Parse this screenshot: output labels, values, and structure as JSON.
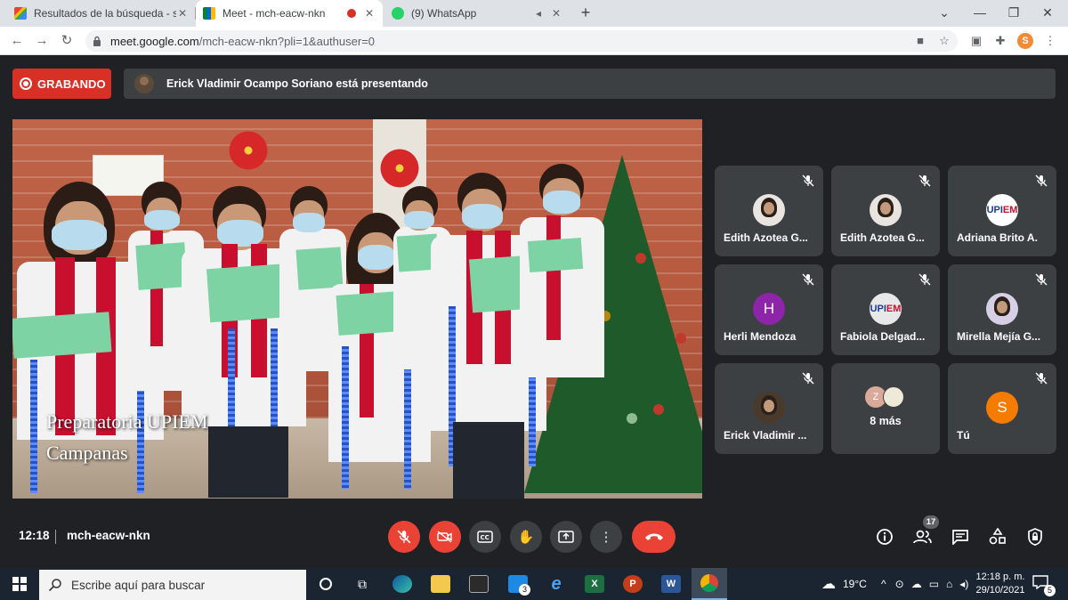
{
  "browser": {
    "tabs": [
      {
        "title": "Resultados de la búsqueda - sub",
        "favicon": "gmail-icon",
        "active": false
      },
      {
        "title": "Meet - mch-eacw-nkn",
        "favicon": "meet-icon",
        "active": true,
        "recording": true
      },
      {
        "title": "(9) WhatsApp",
        "favicon": "whatsapp-icon",
        "active": false,
        "audio": true
      }
    ],
    "url": {
      "host": "meet.google.com",
      "path": "/mch-eacw-nkn?pli=1&authuser=0"
    },
    "profile_initial": "S"
  },
  "meet": {
    "recording_label": "GRABANDO",
    "presenting_text": "Erick Vladimir Ocampo Soriano está presentando",
    "caption_line1": "Preparatoria UPIEM",
    "caption_line2": "Campanas",
    "participants": [
      {
        "name": "Edith Azotea G...",
        "avatar": "photo",
        "muted": true
      },
      {
        "name": "Edith Azotea G...",
        "avatar": "photo",
        "muted": true
      },
      {
        "name": "Adriana Brito A.",
        "avatar": "logo",
        "muted": true
      },
      {
        "name": "Herli Mendoza",
        "avatar": "letter",
        "letter": "H",
        "color": "#8e24aa",
        "muted": true
      },
      {
        "name": "Fabiola Delgad...",
        "avatar": "logo",
        "muted": true
      },
      {
        "name": "Mirella Mejía G...",
        "avatar": "photo",
        "muted": true
      },
      {
        "name": "Erick Vladimir ...",
        "avatar": "photo",
        "muted": true
      },
      {
        "name": "Tú",
        "avatar": "letter",
        "letter": "S",
        "color": "#f57c00",
        "muted": true
      }
    ],
    "more": {
      "letter": "Z",
      "label": "8 más"
    },
    "logo_text": {
      "a": "UPI",
      "b": "EM"
    },
    "clock": "12:18",
    "meeting_code": "mch-eacw-nkn",
    "participant_count": "17"
  },
  "taskbar": {
    "search_placeholder": "Escribe aquí para buscar",
    "mail_badge": "3",
    "temperature": "19°C",
    "time": "12:18 p. m.",
    "date": "29/10/2021",
    "notifications": "5"
  },
  "colors": {
    "accent_red": "#ea4335",
    "tile_bg": "#3c4043",
    "meet_bg": "#202124"
  }
}
